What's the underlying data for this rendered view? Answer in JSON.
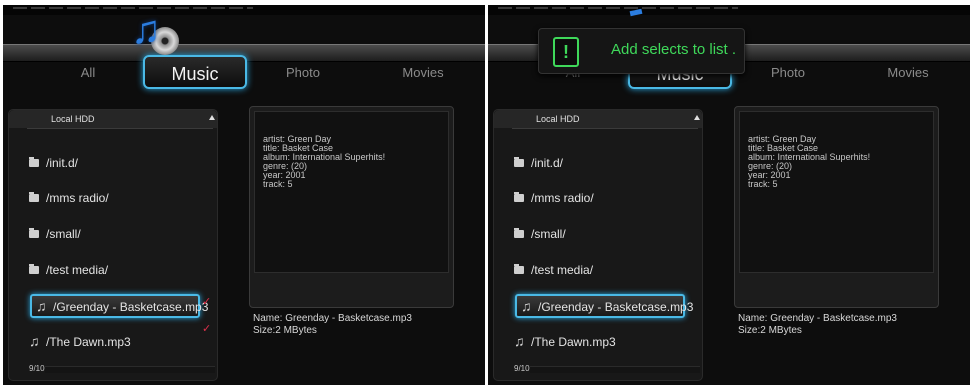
{
  "tabs": [
    "All",
    "Music",
    "Photo",
    "Movies"
  ],
  "list": {
    "header": "Local HDD",
    "items": [
      {
        "label": "/init.d/",
        "icon": "folder-icon"
      },
      {
        "label": "/mms radio/",
        "icon": "folder-icon"
      },
      {
        "label": "/small/",
        "icon": "folder-icon"
      },
      {
        "label": "/test media/",
        "icon": "folder-icon"
      },
      {
        "label": "/Greenday - Basketcase.mp3",
        "icon": "music-note-icon"
      },
      {
        "label": "/The Dawn.mp3",
        "icon": "music-note-icon"
      }
    ],
    "page_count": "9/10",
    "check_mark": "✓"
  },
  "info": {
    "lines": [
      "artist: Green Day",
      "title: Basket Case",
      "album: International Superhits!",
      "genre: (20)",
      "year: 2001",
      "track: 5"
    ],
    "name": "Name: Greenday - Basketcase.mp3",
    "size": "Size:2 MBytes"
  },
  "toast": {
    "icon_text": "!",
    "message": "Add selects to list ."
  },
  "colors": {
    "accent": "#4ab9e6",
    "toast_green": "#3fd85a",
    "check_red": "#e0304b"
  }
}
